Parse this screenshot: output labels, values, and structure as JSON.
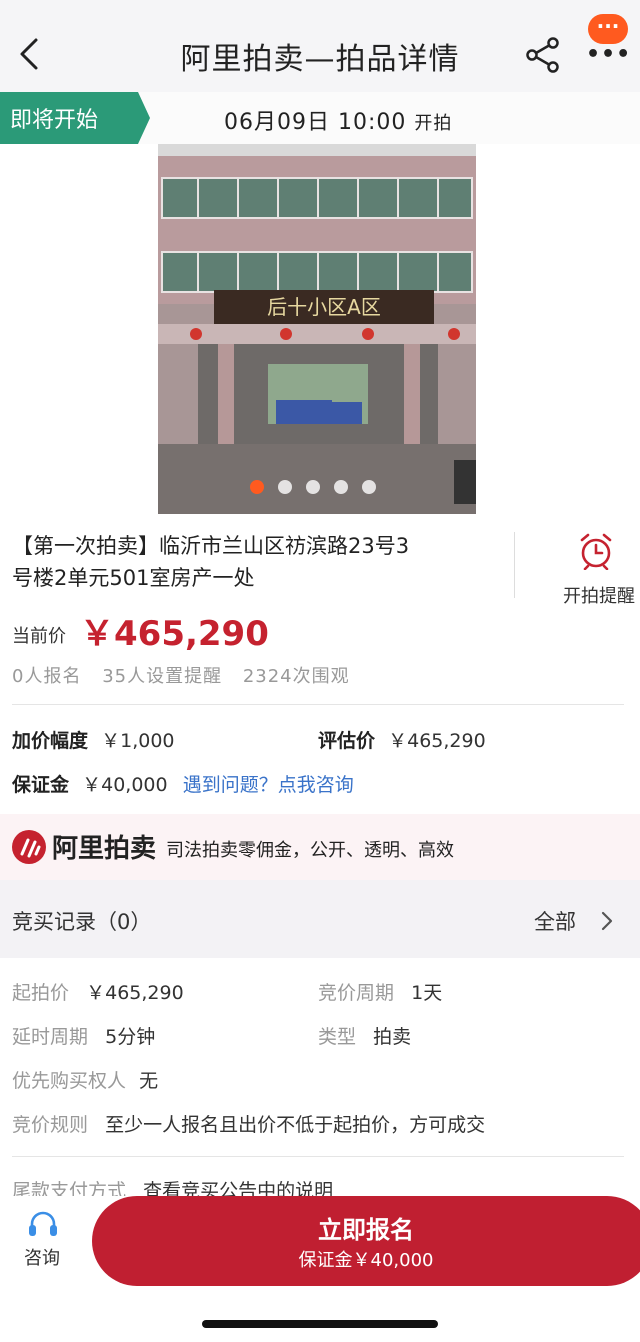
{
  "header": {
    "title": "阿里拍卖—拍品详情",
    "badge_dots": "···",
    "more_dots": "•••"
  },
  "status": {
    "tag": "即将开始",
    "time": "06月09日 10:00",
    "suffix": "开拍"
  },
  "gallery": {
    "sign_text": "后十小区A区",
    "page_count": 5,
    "active_index": 0
  },
  "item": {
    "title_line1": "【第一次拍卖】临沂市兰山区祊滨路23号3",
    "title_line2": "号楼2单元501室房产一处",
    "reminder_label": "开拍提醒",
    "price_label": "当前价",
    "price": "￥465,290",
    "stats": [
      "0人报名",
      "35人设置提醒",
      "2324次围观"
    ]
  },
  "terms": {
    "increment_label": "加价幅度",
    "increment_value": "￥1,000",
    "appraisal_label": "评估价",
    "appraisal_value": "￥465,290",
    "deposit_label": "保证金",
    "deposit_value": "￥40,000",
    "consult_link": "遇到问题？点我咨询"
  },
  "promo": {
    "brand": "阿里拍卖",
    "slogan": "司法拍卖零佣金，公开、透明、高效"
  },
  "records": {
    "title": "竞买记录（0）",
    "all_label": "全部"
  },
  "info": {
    "start_price_label": "起拍价",
    "start_price_value": "￥465,290",
    "cycle_label": "竞价周期",
    "cycle_value": "1天",
    "delay_label": "延时周期",
    "delay_value": "5分钟",
    "type_label": "类型",
    "type_value": "拍卖",
    "priority_label": "优先购买权人",
    "priority_value": "无",
    "rule_label": "竞价规则",
    "rule_value": "至少一人报名且出价不低于起拍价，方可成交",
    "payment_label": "尾款支付方式",
    "payment_value": "查看竞买公告中的说明"
  },
  "bottom": {
    "consult_label": "咨询",
    "cta_main": "立即报名",
    "cta_sub": "保证金￥40,000"
  },
  "colors": {
    "accent": "#c5222f",
    "status_green": "#2b9a78",
    "link": "#3a73c9",
    "badge": "#ff5a1f"
  }
}
